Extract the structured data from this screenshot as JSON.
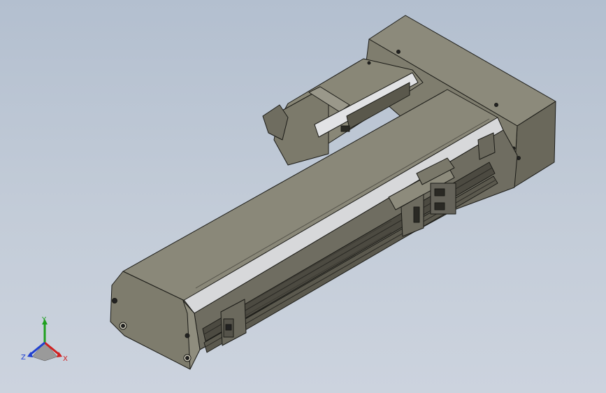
{
  "viewport": {
    "background_top": "#b3bfcf",
    "background_bottom": "#ccd3de"
  },
  "model": {
    "body_color": "#7d7a6a",
    "dark_color": "#4a483e",
    "light_color": "#cfd0d2",
    "edge_color": "#1b1b17"
  },
  "triad": {
    "x_label": "X",
    "y_label": "Y",
    "z_label": "Z",
    "x_color": "#d02020",
    "y_color": "#1fa01f",
    "z_color": "#2040d0"
  }
}
